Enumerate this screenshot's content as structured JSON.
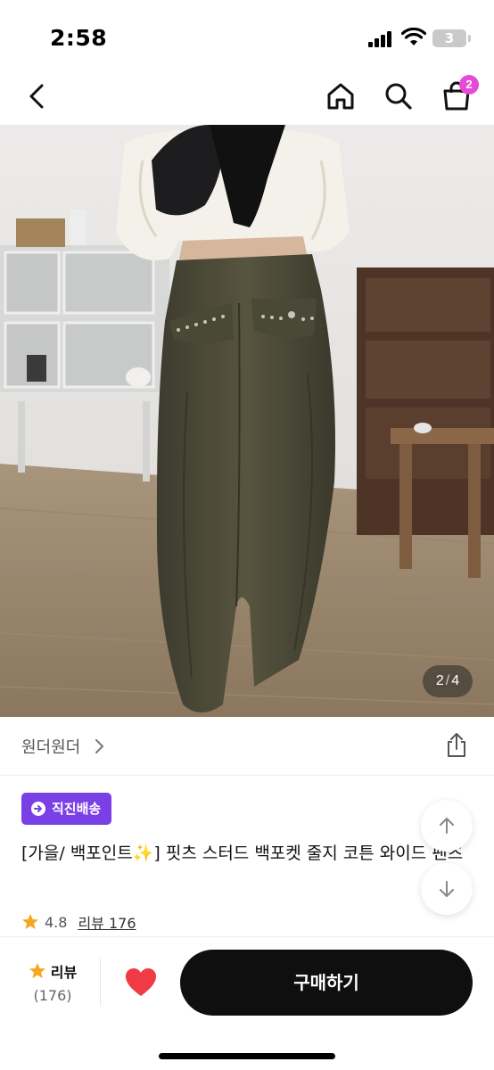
{
  "status_bar": {
    "time": "2:58",
    "battery": "3"
  },
  "nav": {
    "back_icon": "chevron-left-icon",
    "home_icon": "home-icon",
    "search_icon": "search-icon",
    "cart_icon": "shopping-bag-icon",
    "cart_count": "2"
  },
  "gallery": {
    "current": "2",
    "separator": "/",
    "total": "4"
  },
  "shop": {
    "name": "원더원더",
    "chevron_icon": "chevron-right-icon",
    "share_icon": "share-icon"
  },
  "product": {
    "delivery_badge": "직진배송",
    "title": "[가을/ 백포인트✨] 핏츠 스터드 백포켓 줄지 코튼 와이드 팬츠",
    "rating": "4.8",
    "review_link": "리뷰 176"
  },
  "scroll_buttons": {
    "up_icon": "arrow-up-icon",
    "down_icon": "arrow-down-icon"
  },
  "bottom_bar": {
    "review_label": "리뷰",
    "review_count": "(176)",
    "wishlist_icon": "heart-icon",
    "buy_label": "구매하기"
  },
  "colors": {
    "accent_purple": "#7a40e6",
    "badge_pink": "#e64bd8",
    "heart_red": "#ef3b45",
    "star_orange": "#f5a623",
    "buy_button": "#0f0f0f"
  }
}
